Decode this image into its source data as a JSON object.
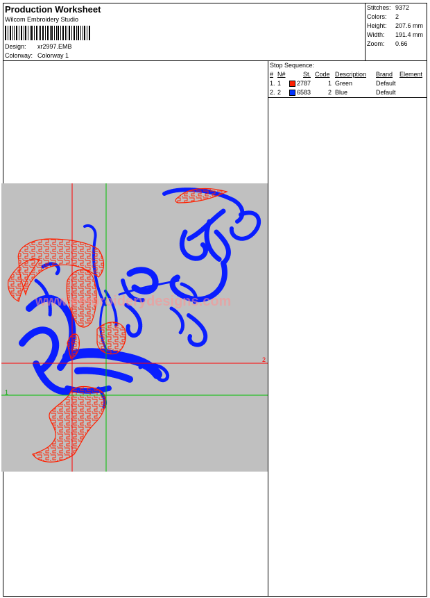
{
  "header": {
    "title": "Production Worksheet",
    "software": "Wilcom Embroidery Studio",
    "design_label": "Design:",
    "design_value": "xr2997.EMB",
    "colorway_label": "Colorway:",
    "colorway_value": "Colorway 1"
  },
  "stats": [
    {
      "label": "Stitches:",
      "value": "9372"
    },
    {
      "label": "Colors:",
      "value": "2"
    },
    {
      "label": "Height:",
      "value": "207.6 mm"
    },
    {
      "label": "Width:",
      "value": "191.4 mm"
    },
    {
      "label": "Zoom:",
      "value": "0.66"
    }
  ],
  "stop_sequence": {
    "title": "Stop Sequence:",
    "columns": [
      "#",
      "N#",
      "St.",
      "Code",
      "Description",
      "Brand",
      "Element"
    ],
    "rows": [
      {
        "num": "1.",
        "n": "1",
        "color": "#ff2000",
        "st": "2787",
        "code": "1",
        "description": "Green",
        "brand": "Default",
        "element": ""
      },
      {
        "num": "2.",
        "n": "2",
        "color": "#0033ff",
        "st": "6583",
        "code": "2",
        "description": "Blue",
        "brand": "Default",
        "element": ""
      }
    ]
  },
  "preview": {
    "watermark": "www.embroiderydesigns.com",
    "marker_1": "1",
    "marker_2": "2",
    "colors": {
      "background": "#c0c0c0",
      "red_stitch": "#ff2000",
      "blue_stitch": "#0a1eff",
      "red_guide": "#ff0000",
      "green_guide": "#00c000"
    }
  }
}
